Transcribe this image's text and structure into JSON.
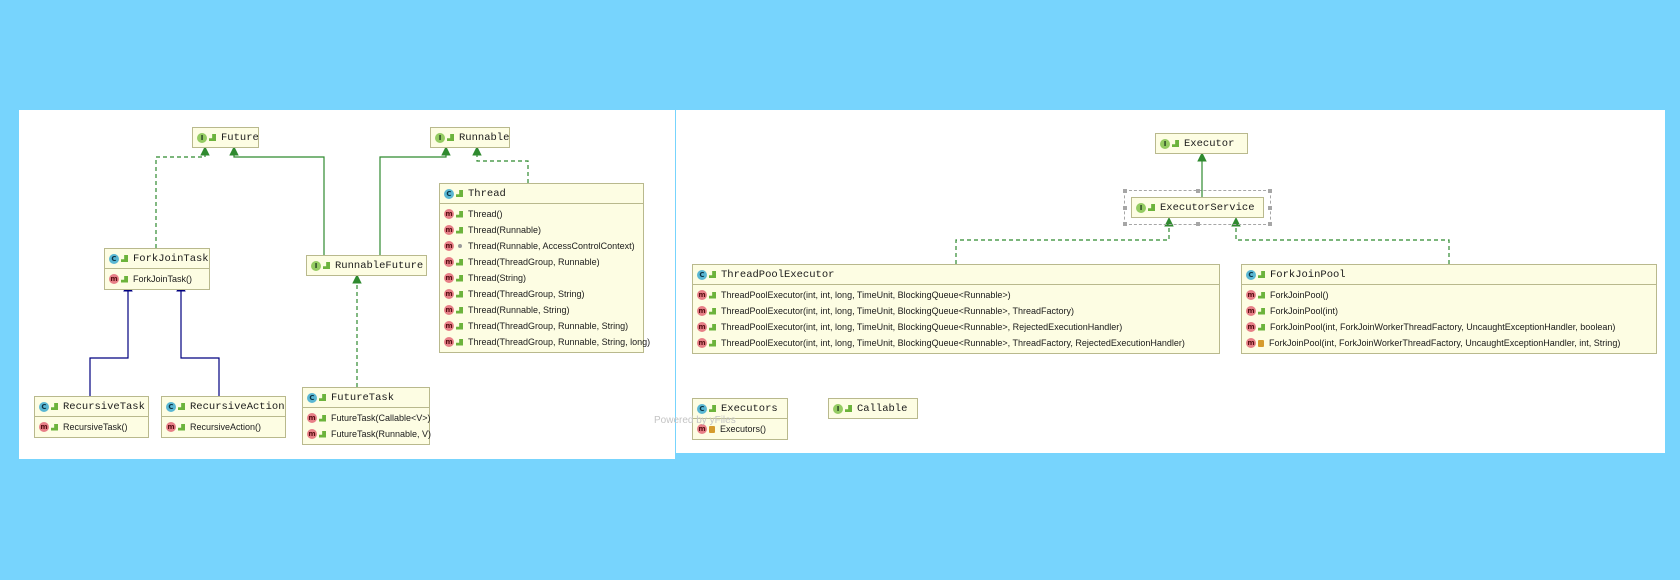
{
  "colors": {
    "background": "#77d4fd",
    "node_fill": "#fdfde3",
    "node_border": "#b9b98d",
    "interface_edge": "#2f8a2f",
    "class_edge": "#000080"
  },
  "nodes": {
    "future": {
      "badge": "I",
      "name": "Future",
      "members": []
    },
    "runnable": {
      "badge": "I",
      "name": "Runnable",
      "members": []
    },
    "thread": {
      "badge": "C",
      "name": "Thread",
      "members": [
        {
          "vis": "public",
          "label": "Thread()"
        },
        {
          "vis": "public",
          "label": "Thread(Runnable)"
        },
        {
          "vis": "package",
          "label": "Thread(Runnable, AccessControlContext)"
        },
        {
          "vis": "public",
          "label": "Thread(ThreadGroup, Runnable)"
        },
        {
          "vis": "public",
          "label": "Thread(String)"
        },
        {
          "vis": "public",
          "label": "Thread(ThreadGroup, String)"
        },
        {
          "vis": "public",
          "label": "Thread(Runnable, String)"
        },
        {
          "vis": "public",
          "label": "Thread(ThreadGroup, Runnable, String)"
        },
        {
          "vis": "public",
          "label": "Thread(ThreadGroup, Runnable, String, long)"
        }
      ]
    },
    "forkjointask": {
      "badge": "C",
      "name": "ForkJoinTask",
      "members": [
        {
          "vis": "public",
          "label": "ForkJoinTask()"
        }
      ]
    },
    "runnablefuture": {
      "badge": "I",
      "name": "RunnableFuture",
      "members": []
    },
    "recursivetask": {
      "badge": "C",
      "name": "RecursiveTask",
      "members": [
        {
          "vis": "public",
          "label": "RecursiveTask()"
        }
      ]
    },
    "recursiveaction": {
      "badge": "C",
      "name": "RecursiveAction",
      "members": [
        {
          "vis": "public",
          "label": "RecursiveAction()"
        }
      ]
    },
    "futuretask": {
      "badge": "C",
      "name": "FutureTask",
      "members": [
        {
          "vis": "public",
          "label": "FutureTask(Callable<V>)"
        },
        {
          "vis": "public",
          "label": "FutureTask(Runnable, V)"
        }
      ]
    },
    "executor": {
      "badge": "I",
      "name": "Executor",
      "members": []
    },
    "executorservice": {
      "badge": "I",
      "name": "ExecutorService",
      "members": []
    },
    "threadpoolexecutor": {
      "badge": "C",
      "name": "ThreadPoolExecutor",
      "members": [
        {
          "vis": "public",
          "label": "ThreadPoolExecutor(int, int, long, TimeUnit, BlockingQueue<Runnable>)"
        },
        {
          "vis": "public",
          "label": "ThreadPoolExecutor(int, int, long, TimeUnit, BlockingQueue<Runnable>, ThreadFactory)"
        },
        {
          "vis": "public",
          "label": "ThreadPoolExecutor(int, int, long, TimeUnit, BlockingQueue<Runnable>, RejectedExecutionHandler)"
        },
        {
          "vis": "public",
          "label": "ThreadPoolExecutor(int, int, long, TimeUnit, BlockingQueue<Runnable>, ThreadFactory, RejectedExecutionHandler)"
        }
      ]
    },
    "forkjoinpool": {
      "badge": "C",
      "name": "ForkJoinPool",
      "members": [
        {
          "vis": "public",
          "label": "ForkJoinPool()"
        },
        {
          "vis": "public",
          "label": "ForkJoinPool(int)"
        },
        {
          "vis": "public",
          "label": "ForkJoinPool(int, ForkJoinWorkerThreadFactory, UncaughtExceptionHandler, boolean)"
        },
        {
          "vis": "private",
          "label": "ForkJoinPool(int, ForkJoinWorkerThreadFactory, UncaughtExceptionHandler, int, String)"
        }
      ]
    },
    "executors": {
      "badge": "C",
      "name": "Executors",
      "members": [
        {
          "vis": "private",
          "label": "Executors()"
        }
      ]
    },
    "callable": {
      "badge": "I",
      "name": "Callable",
      "members": []
    }
  },
  "relations": [
    {
      "from": "forkjointask",
      "to": "future",
      "kind": "implements"
    },
    {
      "from": "runnablefuture",
      "to": "future",
      "kind": "extends-interface"
    },
    {
      "from": "runnablefuture",
      "to": "runnable",
      "kind": "extends-interface"
    },
    {
      "from": "thread",
      "to": "runnable",
      "kind": "implements"
    },
    {
      "from": "recursivetask",
      "to": "forkjointask",
      "kind": "extends-class"
    },
    {
      "from": "recursiveaction",
      "to": "forkjointask",
      "kind": "extends-class"
    },
    {
      "from": "futuretask",
      "to": "runnablefuture",
      "kind": "implements"
    },
    {
      "from": "executorservice",
      "to": "executor",
      "kind": "extends-interface"
    },
    {
      "from": "threadpoolexecutor",
      "to": "executorservice",
      "kind": "implements"
    },
    {
      "from": "forkjoinpool",
      "to": "executorservice",
      "kind": "implements"
    }
  ],
  "watermark": "Powered by yFiles"
}
